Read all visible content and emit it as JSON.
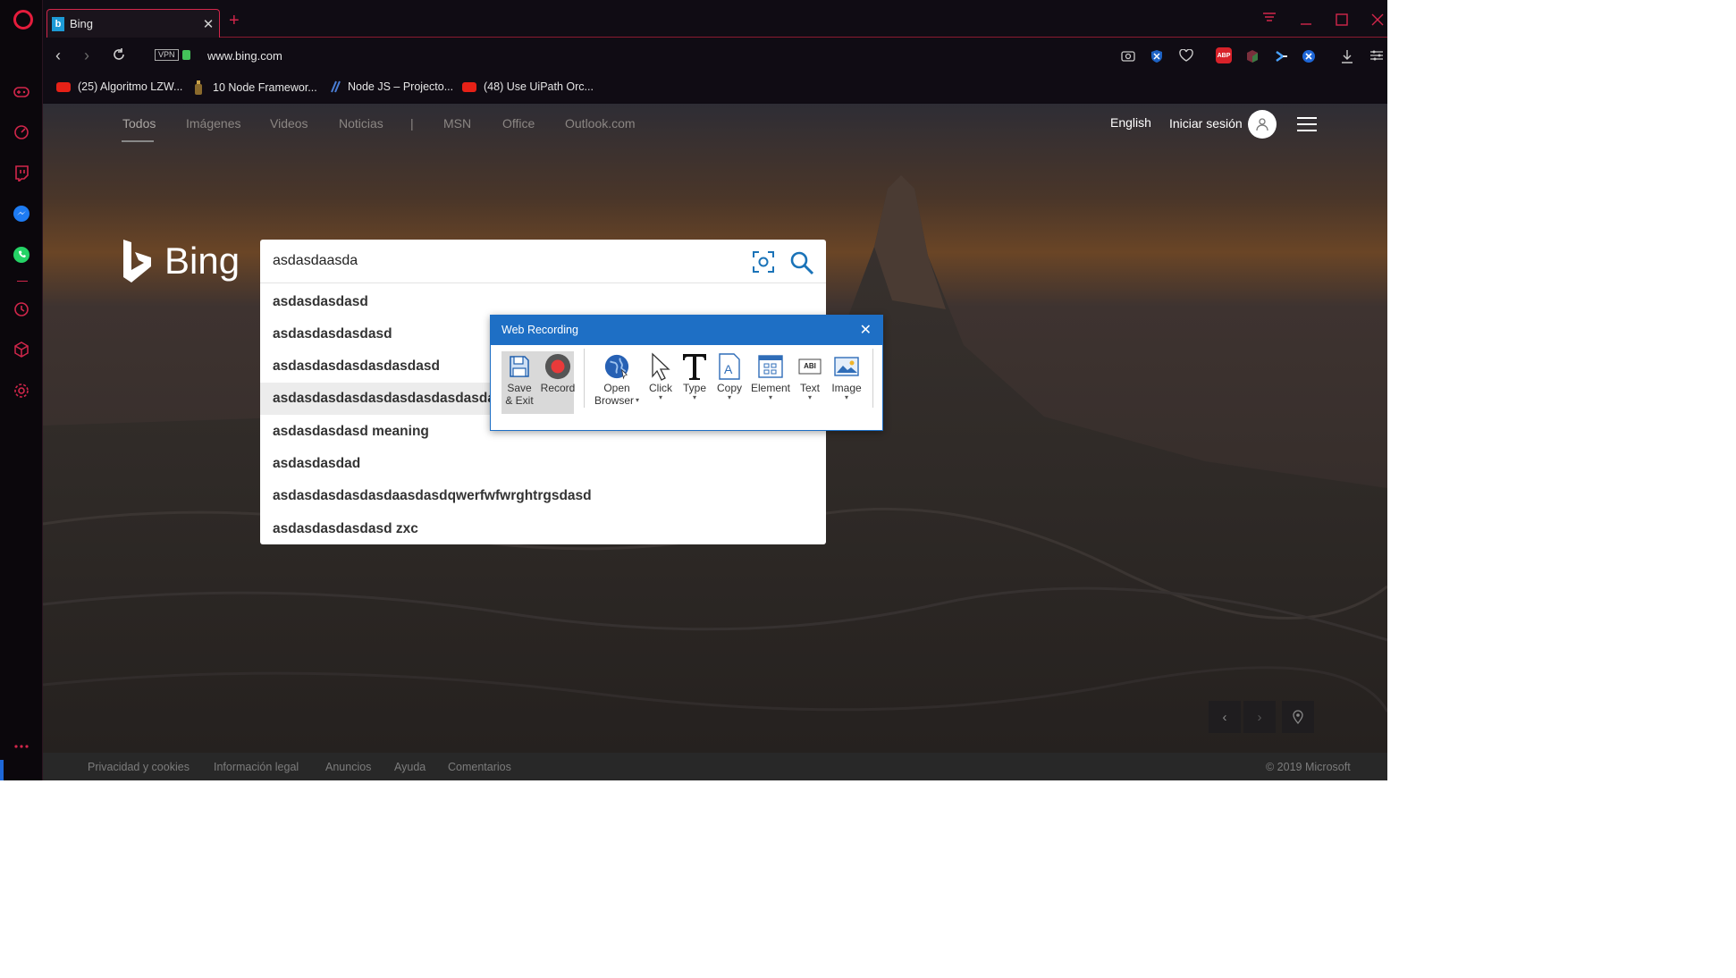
{
  "browser": {
    "tab_title": "Bing",
    "tab_favicon": "b",
    "url": "www.bing.com",
    "vpn_label": "VPN",
    "bookmarks": [
      {
        "label": "(25) Algoritmo LZW..."
      },
      {
        "label": "10 Node Framewor..."
      },
      {
        "label": "Node JS – Projecto..."
      },
      {
        "label": "(48) Use UiPath Orc..."
      }
    ],
    "ext_abp": "ABP",
    "accent_color": "#d2264b"
  },
  "bing": {
    "nav": [
      "Todos",
      "Imágenes",
      "Videos",
      "Noticias",
      "|",
      "MSN",
      "Office",
      "Outlook.com"
    ],
    "language": "English",
    "signin": "Iniciar sesión",
    "logo_text": "Bing",
    "search_value": "asdasdaasda",
    "suggestions": [
      "asdasdasdasd",
      "asdasdasdasdasd",
      "asdasdasdasdasdasdasd",
      "asdasdasdasdasdasdasdasdasdasd",
      "asdasdasdasd meaning",
      "asdasdasdad",
      "asdasdasdasdasdaasdasdqwerfwfwrghtrgsdasd",
      "asdasdasdasdasd zxc"
    ],
    "footer_links": [
      "Privacidad y cookies",
      "Información legal",
      "Anuncios",
      "Ayuda",
      "Comentarios"
    ],
    "copyright": "© 2019 Microsoft"
  },
  "recorder": {
    "title": "Web Recording",
    "tools": [
      {
        "label1": "Save",
        "label2": "& Exit",
        "icon": "floppy-icon"
      },
      {
        "label1": "Record",
        "label2": "",
        "icon": "record-icon"
      },
      {
        "label1": "Open",
        "label2": "Browser",
        "icon": "globe-icon"
      },
      {
        "label1": "Click",
        "label2": "",
        "icon": "cursor-icon"
      },
      {
        "label1": "Type",
        "label2": "",
        "icon": "type-icon"
      },
      {
        "label1": "Copy",
        "label2": "",
        "icon": "copy-icon"
      },
      {
        "label1": "Element",
        "label2": "",
        "icon": "element-icon"
      },
      {
        "label1": "Text",
        "label2": "",
        "icon": "text-icon"
      },
      {
        "label1": "Image",
        "label2": "",
        "icon": "image-icon"
      }
    ],
    "text_icon_label": "ABI",
    "header_color": "#1e6fc5"
  }
}
